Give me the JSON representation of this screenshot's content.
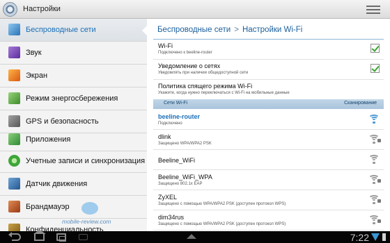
{
  "header": {
    "title": "Настройки"
  },
  "sidebar": {
    "items": [
      {
        "label": "Беспроводные сети",
        "icon": "wifi-settings-icon",
        "selected": true
      },
      {
        "label": "Звук",
        "icon": "sound-icon"
      },
      {
        "label": "Экран",
        "icon": "display-icon"
      },
      {
        "label": "Режим энергосбережения",
        "icon": "power-saving-icon"
      },
      {
        "label": "GPS и безопасность",
        "icon": "gps-security-icon"
      },
      {
        "label": "Приложения",
        "icon": "apps-icon"
      },
      {
        "label": "Учетные записи и синхронизация",
        "icon": "sync-icon"
      },
      {
        "label": "Датчик движения",
        "icon": "motion-sensor-icon"
      },
      {
        "label": "Брандмауэр",
        "icon": "firewall-icon"
      },
      {
        "label": "Конфиденциальность",
        "icon": "privacy-icon"
      }
    ]
  },
  "watermark": "mobile-review.com",
  "detail": {
    "breadcrumb": {
      "parent": "Беспроводные сети",
      "separator": ">",
      "current": "Настройки Wi-Fi"
    },
    "prefs": [
      {
        "title": "Wi-Fi",
        "summary": "Подключено к beeline-router",
        "checked": true
      },
      {
        "title": "Уведомление о сетях",
        "summary": "Уведомлять при наличии общедоступной сети",
        "checked": true
      },
      {
        "title": "Политика спящего режима Wi-Fi",
        "summary": "Укажите, когда нужно переключаться с Wi-Fi на мобильные данные"
      }
    ],
    "networks_header": {
      "left": "Сети Wi-Fi",
      "right": "Сканирование"
    },
    "networks": [
      {
        "ssid": "beeline-router",
        "status": "Подключено",
        "connected": true
      },
      {
        "ssid": "dlink",
        "status": "Защищено WPA/WPA2 PSK",
        "secured": true
      },
      {
        "ssid": "Beeline_WiFi",
        "status": ""
      },
      {
        "ssid": "Beeline_WiFi_WPA",
        "status": "Защищено 802.1x EAP",
        "secured": true
      },
      {
        "ssid": "ZyXEL",
        "status": "Защищено с помощью WPA/WPA2 PSK (доступен протокол WPS)",
        "secured": true
      },
      {
        "ssid": "dim34rus",
        "status": "Защищено с помощью WPA/WPA2 PSK (доступен протокол WPS)",
        "secured": true
      }
    ]
  },
  "system_bar": {
    "time": "7:22"
  },
  "colors": {
    "accent": "#1b6fb8",
    "check": "#3aa533",
    "category_bg": "#b5cde2"
  }
}
